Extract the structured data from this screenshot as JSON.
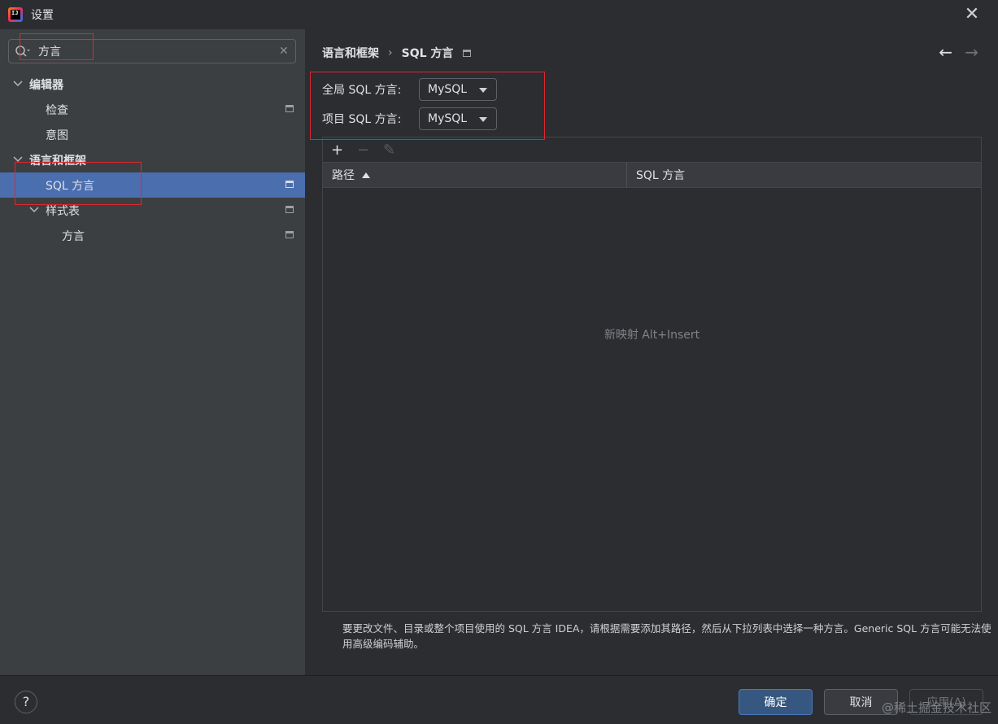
{
  "window": {
    "title": "设置",
    "logo_text": "IJ"
  },
  "search": {
    "value": "方言",
    "placeholder": ""
  },
  "tree": {
    "items": [
      {
        "label": "编辑器",
        "level": 0,
        "chevron": "⌄",
        "bold": true,
        "badge": false,
        "selected": false
      },
      {
        "label": "检查",
        "level": 1,
        "chevron": "",
        "bold": false,
        "badge": true,
        "selected": false
      },
      {
        "label": "意图",
        "level": 1,
        "chevron": "",
        "bold": false,
        "badge": false,
        "selected": false
      },
      {
        "label": "语言和框架",
        "level": 0,
        "chevron": "⌄",
        "bold": true,
        "badge": false,
        "selected": false
      },
      {
        "label": "SQL 方言",
        "level": 1,
        "chevron": "",
        "bold": false,
        "badge": true,
        "selected": true
      },
      {
        "label": "样式表",
        "level": 1,
        "chevron": "⌄",
        "bold": false,
        "badge": true,
        "selected": false
      },
      {
        "label": "方言",
        "level": 2,
        "chevron": "",
        "bold": false,
        "badge": true,
        "selected": false
      }
    ]
  },
  "breadcrumb": {
    "parent": "语言和框架",
    "separator": "›",
    "current": "SQL 方言"
  },
  "nav": {
    "back": "←",
    "forward": "→"
  },
  "fields": {
    "global_label": "全局 SQL 方言:",
    "global_value": "MySQL",
    "project_label": "项目 SQL 方言:",
    "project_value": "MySQL"
  },
  "table": {
    "toolbar": {
      "add": "+",
      "remove": "−",
      "edit": "✎"
    },
    "columns": [
      "路径",
      "SQL 方言"
    ],
    "empty_text": "新映射 Alt+Insert"
  },
  "help_text": "要更改文件、目录或整个项目使用的 SQL 方言 IDEA，请根据需要添加其路径，然后从下拉列表中选择一种方言。Generic SQL 方言可能无法使用高级编码辅助。",
  "buttons": {
    "help": "?",
    "ok": "确定",
    "cancel": "取消",
    "apply": "应用(A)"
  },
  "watermark": "@稀土掘金技术社区",
  "colors": {
    "selection": "#4b6eaf",
    "annotation": "#e0262f",
    "primary_button": "#365880"
  }
}
